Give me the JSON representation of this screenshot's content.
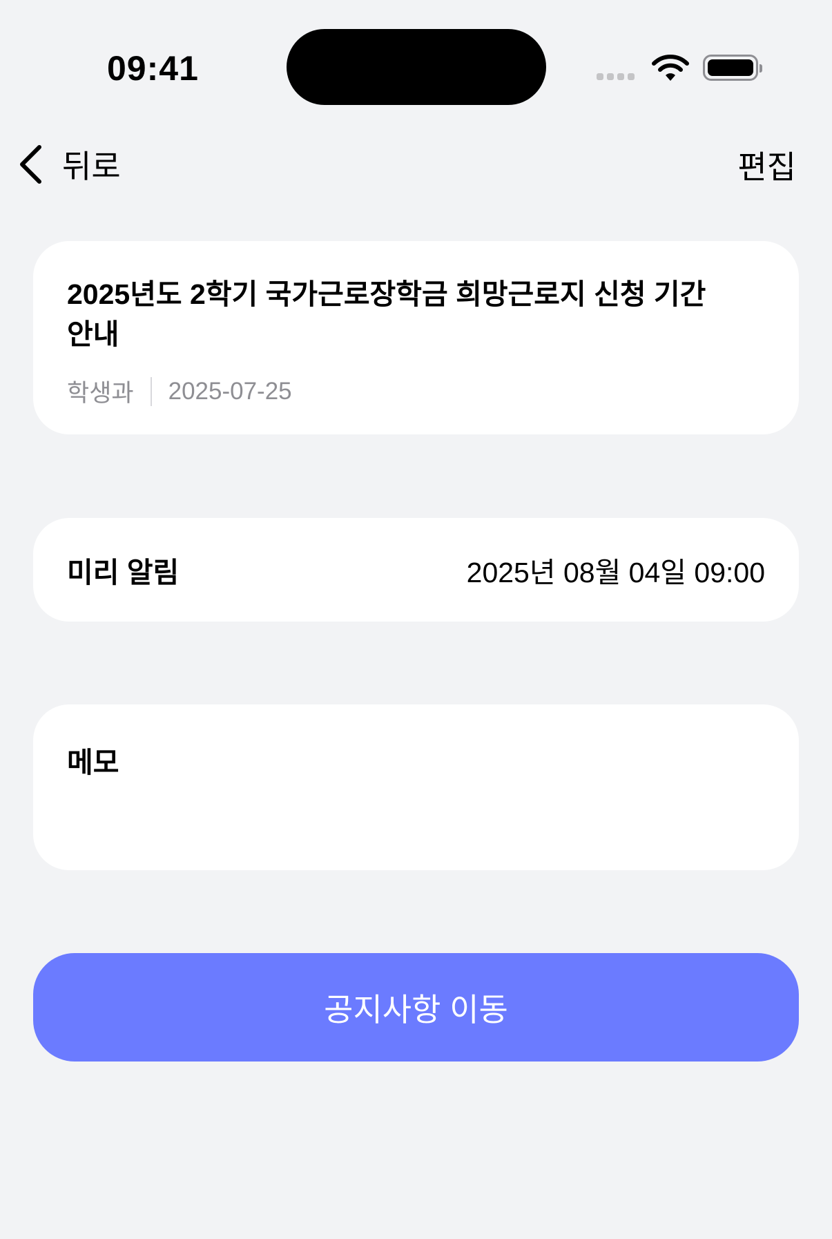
{
  "status_bar": {
    "time": "09:41"
  },
  "nav": {
    "back_label": "뒤로",
    "edit_label": "편집"
  },
  "notice": {
    "title": "2025년도 2학기 국가근로장학금 희망근로지 신청 기간 안내",
    "department": "학생과",
    "date": "2025-07-25"
  },
  "reminder": {
    "label": "미리 알림",
    "value": "2025년 08월 04일 09:00"
  },
  "memo": {
    "label": "메모"
  },
  "action": {
    "label": "공지사항 이동"
  },
  "colors": {
    "accent": "#6b7bff",
    "background": "#f2f3f5"
  }
}
